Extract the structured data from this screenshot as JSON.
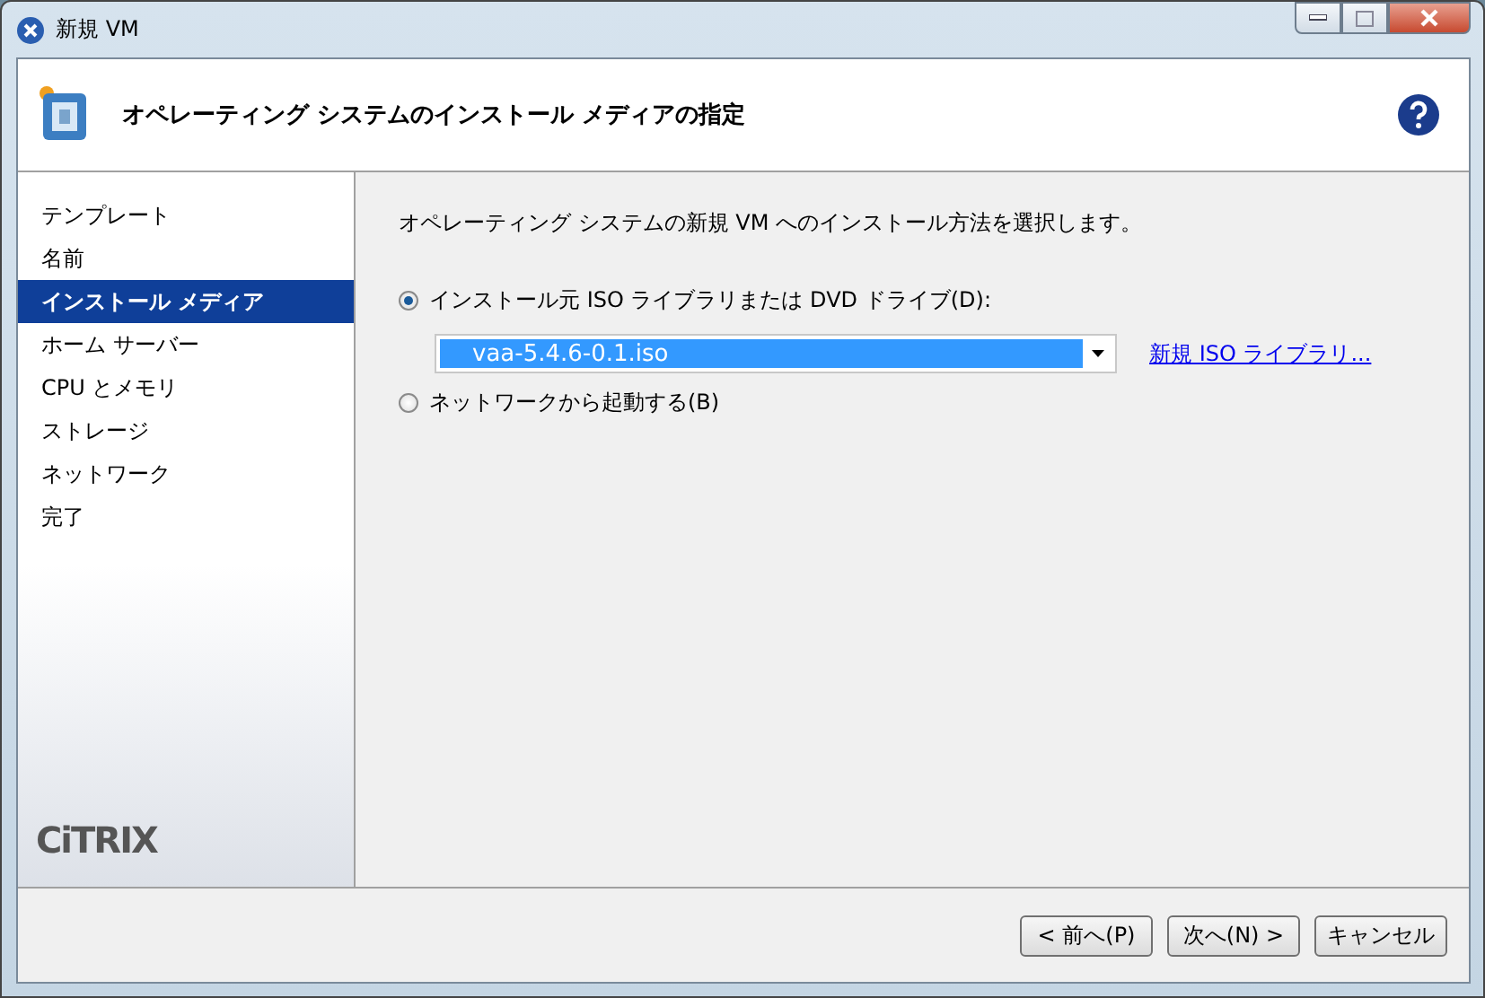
{
  "window": {
    "title": "新規 VM"
  },
  "header": {
    "title": "オペレーティング システムのインストール メディアの指定"
  },
  "sidebar": {
    "items": [
      {
        "label": "テンプレート",
        "selected": false
      },
      {
        "label": "名前",
        "selected": false
      },
      {
        "label": "インストール メディア",
        "selected": true
      },
      {
        "label": "ホーム サーバー",
        "selected": false
      },
      {
        "label": "CPU とメモリ",
        "selected": false
      },
      {
        "label": "ストレージ",
        "selected": false
      },
      {
        "label": "ネットワーク",
        "selected": false
      },
      {
        "label": "完了",
        "selected": false
      }
    ],
    "logo": "CiTRIX"
  },
  "content": {
    "instruction": "オペレーティング システムの新規 VM へのインストール方法を選択します。",
    "options": [
      {
        "label": "インストール元 ISO ライブラリまたは DVD ドライブ(D):",
        "selected": true
      },
      {
        "label": "ネットワークから起動する(B)",
        "selected": false
      }
    ],
    "iso_select": {
      "value": "vaa-5.4.6-0.1.iso"
    },
    "new_library_link": "新規 ISO ライブラリ..."
  },
  "buttons": [
    {
      "label": "< 前へ(P)"
    },
    {
      "label": "次へ(N) >"
    },
    {
      "label": "キャンセル"
    }
  ]
}
